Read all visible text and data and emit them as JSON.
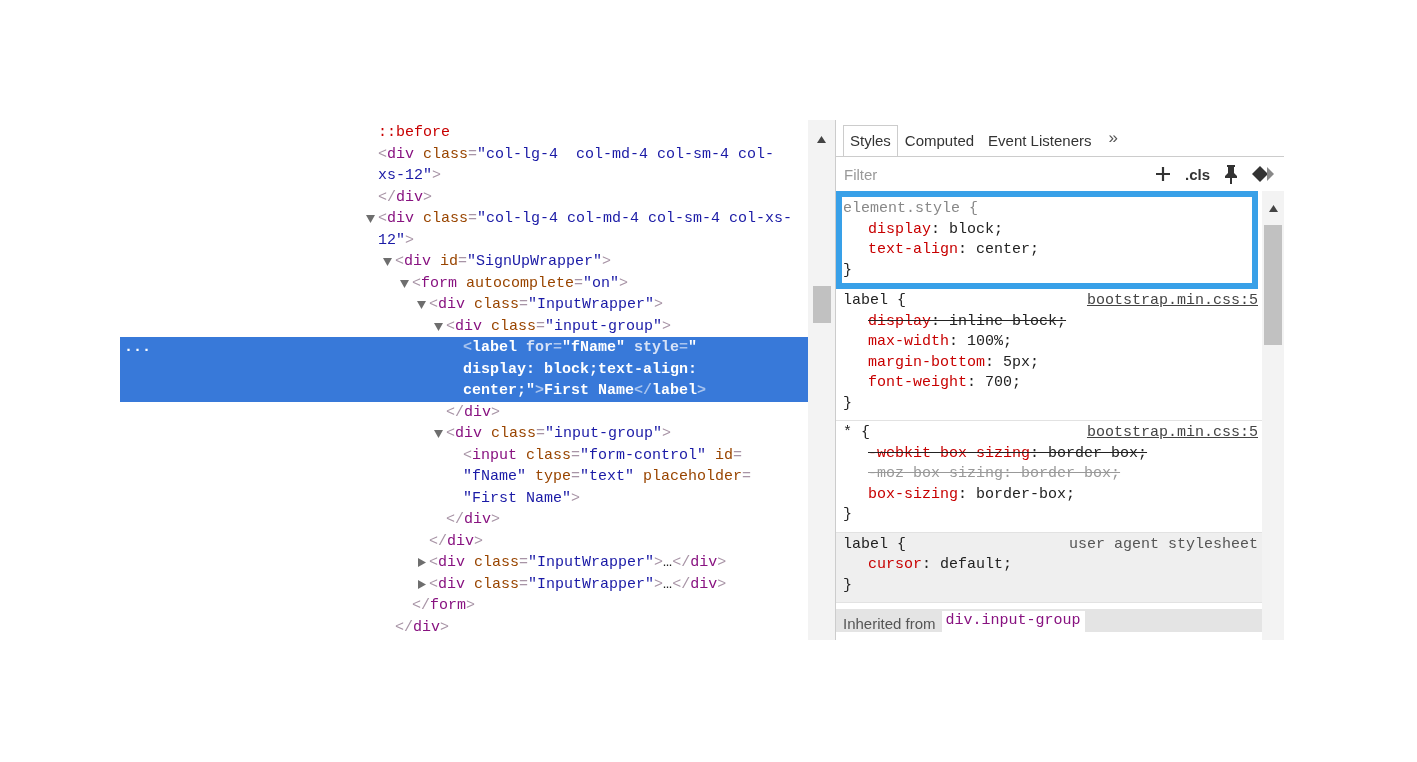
{
  "elements": {
    "tree": [
      {
        "selected": false,
        "lines": [
          [
            {
              "kind": "pseudo",
              "text": "::before"
            }
          ]
        ]
      },
      {
        "selected": false,
        "lines": [
          [
            {
              "kind": "punct",
              "text": "<"
            },
            {
              "kind": "tag",
              "text": "div"
            },
            {
              "kind": "attr",
              "text": " class"
            },
            {
              "kind": "punct",
              "text": "="
            },
            {
              "kind": "value",
              "text": "\"col-lg-4  col-md-4 col-sm-4 col-"
            }
          ],
          [
            {
              "kind": "value",
              "text": "xs-12\""
            },
            {
              "kind": "punct",
              "text": ">"
            }
          ]
        ],
        "close": [
          {
            "kind": "punct",
            "text": "</"
          },
          {
            "kind": "tag",
            "text": "div"
          },
          {
            "kind": "punct",
            "text": ">"
          }
        ]
      },
      {
        "selected": false,
        "expanded": true,
        "lines": [
          [
            {
              "kind": "punct",
              "text": "<"
            },
            {
              "kind": "tag",
              "text": "div"
            },
            {
              "kind": "attr",
              "text": " class"
            },
            {
              "kind": "punct",
              "text": "="
            },
            {
              "kind": "value",
              "text": "\"col-lg-4 col-md-4 col-sm-4 col-xs-"
            }
          ],
          [
            {
              "kind": "value",
              "text": "12\""
            },
            {
              "kind": "punct",
              "text": ">"
            }
          ]
        ],
        "children": [
          {
            "selected": false,
            "expanded": true,
            "lines": [
              [
                {
                  "kind": "punct",
                  "text": "<"
                },
                {
                  "kind": "tag",
                  "text": "div"
                },
                {
                  "kind": "attr",
                  "text": " id"
                },
                {
                  "kind": "punct",
                  "text": "="
                },
                {
                  "kind": "value",
                  "text": "\"SignUpWrapper\""
                },
                {
                  "kind": "punct",
                  "text": ">"
                }
              ]
            ],
            "close": [
              {
                "kind": "punct",
                "text": "</"
              },
              {
                "kind": "tag",
                "text": "div"
              },
              {
                "kind": "punct",
                "text": ">"
              }
            ],
            "children": [
              {
                "selected": false,
                "expanded": true,
                "lines": [
                  [
                    {
                      "kind": "punct",
                      "text": "<"
                    },
                    {
                      "kind": "tag",
                      "text": "form"
                    },
                    {
                      "kind": "attr",
                      "text": " autocomplete"
                    },
                    {
                      "kind": "punct",
                      "text": "="
                    },
                    {
                      "kind": "value",
                      "text": "\"on\""
                    },
                    {
                      "kind": "punct",
                      "text": ">"
                    }
                  ]
                ],
                "close": [
                  {
                    "kind": "punct",
                    "text": "</"
                  },
                  {
                    "kind": "tag",
                    "text": "form"
                  },
                  {
                    "kind": "punct",
                    "text": ">"
                  }
                ],
                "children": [
                  {
                    "selected": false,
                    "expanded": true,
                    "lines": [
                      [
                        {
                          "kind": "punct",
                          "text": "<"
                        },
                        {
                          "kind": "tag",
                          "text": "div"
                        },
                        {
                          "kind": "attr",
                          "text": " class"
                        },
                        {
                          "kind": "punct",
                          "text": "="
                        },
                        {
                          "kind": "value",
                          "text": "\"InputWrapper\""
                        },
                        {
                          "kind": "punct",
                          "text": ">"
                        }
                      ]
                    ],
                    "close": [
                      {
                        "kind": "punct",
                        "text": "</"
                      },
                      {
                        "kind": "tag",
                        "text": "div"
                      },
                      {
                        "kind": "punct",
                        "text": ">"
                      }
                    ],
                    "children": [
                      {
                        "selected": false,
                        "expanded": true,
                        "lines": [
                          [
                            {
                              "kind": "punct",
                              "text": "<"
                            },
                            {
                              "kind": "tag",
                              "text": "div"
                            },
                            {
                              "kind": "attr",
                              "text": " class"
                            },
                            {
                              "kind": "punct",
                              "text": "="
                            },
                            {
                              "kind": "value",
                              "text": "\"input-group\""
                            },
                            {
                              "kind": "punct",
                              "text": ">"
                            }
                          ]
                        ],
                        "close": [
                          {
                            "kind": "punct",
                            "text": "</"
                          },
                          {
                            "kind": "tag",
                            "text": "div"
                          },
                          {
                            "kind": "punct",
                            "text": ">"
                          }
                        ],
                        "children": [
                          {
                            "selected": true,
                            "gutter": "...",
                            "lines": [
                              [
                                {
                                  "kind": "punct",
                                  "text": "<"
                                },
                                {
                                  "kind": "tag",
                                  "text": "label"
                                },
                                {
                                  "kind": "attr",
                                  "text": " for"
                                },
                                {
                                  "kind": "punct",
                                  "text": "="
                                },
                                {
                                  "kind": "value",
                                  "text": "\"fName\""
                                },
                                {
                                  "kind": "attr",
                                  "text": " style"
                                },
                                {
                                  "kind": "punct",
                                  "text": "="
                                },
                                {
                                  "kind": "value",
                                  "text": "\""
                                }
                              ],
                              [
                                {
                                  "kind": "value",
                                  "text": "display: block;text-align:"
                                }
                              ],
                              [
                                {
                                  "kind": "value",
                                  "text": "center;\""
                                },
                                {
                                  "kind": "punct",
                                  "text": ">"
                                },
                                {
                                  "kind": "text",
                                  "text": "First Name"
                                },
                                {
                                  "kind": "punct",
                                  "text": "</"
                                },
                                {
                                  "kind": "tag",
                                  "text": "label"
                                },
                                {
                                  "kind": "punct",
                                  "text": ">"
                                }
                              ]
                            ]
                          }
                        ]
                      },
                      {
                        "selected": false,
                        "expanded": true,
                        "lines": [
                          [
                            {
                              "kind": "punct",
                              "text": "<"
                            },
                            {
                              "kind": "tag",
                              "text": "div"
                            },
                            {
                              "kind": "attr",
                              "text": " class"
                            },
                            {
                              "kind": "punct",
                              "text": "="
                            },
                            {
                              "kind": "value",
                              "text": "\"input-group\""
                            },
                            {
                              "kind": "punct",
                              "text": ">"
                            }
                          ]
                        ],
                        "close": [
                          {
                            "kind": "punct",
                            "text": "</"
                          },
                          {
                            "kind": "tag",
                            "text": "div"
                          },
                          {
                            "kind": "punct",
                            "text": ">"
                          }
                        ],
                        "children": [
                          {
                            "selected": false,
                            "lines": [
                              [
                                {
                                  "kind": "punct",
                                  "text": "<"
                                },
                                {
                                  "kind": "tag",
                                  "text": "input"
                                },
                                {
                                  "kind": "attr",
                                  "text": " class"
                                },
                                {
                                  "kind": "punct",
                                  "text": "="
                                },
                                {
                                  "kind": "value",
                                  "text": "\"form-control\""
                                },
                                {
                                  "kind": "attr",
                                  "text": " id"
                                },
                                {
                                  "kind": "punct",
                                  "text": "="
                                }
                              ],
                              [
                                {
                                  "kind": "value",
                                  "text": "\"fName\""
                                },
                                {
                                  "kind": "attr",
                                  "text": " type"
                                },
                                {
                                  "kind": "punct",
                                  "text": "="
                                },
                                {
                                  "kind": "value",
                                  "text": "\"text\""
                                },
                                {
                                  "kind": "attr",
                                  "text": " placeholder"
                                },
                                {
                                  "kind": "punct",
                                  "text": "="
                                }
                              ],
                              [
                                {
                                  "kind": "value",
                                  "text": "\"First Name\""
                                },
                                {
                                  "kind": "punct",
                                  "text": ">"
                                }
                              ]
                            ]
                          }
                        ]
                      }
                    ]
                  },
                  {
                    "selected": false,
                    "expanded": false,
                    "lines": [
                      [
                        {
                          "kind": "punct",
                          "text": "<"
                        },
                        {
                          "kind": "tag",
                          "text": "div"
                        },
                        {
                          "kind": "attr",
                          "text": " class"
                        },
                        {
                          "kind": "punct",
                          "text": "="
                        },
                        {
                          "kind": "value",
                          "text": "\"InputWrapper\""
                        },
                        {
                          "kind": "punct",
                          "text": ">"
                        },
                        {
                          "kind": "text",
                          "text": "…"
                        },
                        {
                          "kind": "punct",
                          "text": "</"
                        },
                        {
                          "kind": "tag",
                          "text": "div"
                        },
                        {
                          "kind": "punct",
                          "text": ">"
                        }
                      ]
                    ]
                  },
                  {
                    "selected": false,
                    "expanded": false,
                    "lines": [
                      [
                        {
                          "kind": "punct",
                          "text": "<"
                        },
                        {
                          "kind": "tag",
                          "text": "div"
                        },
                        {
                          "kind": "attr",
                          "text": " class"
                        },
                        {
                          "kind": "punct",
                          "text": "="
                        },
                        {
                          "kind": "value",
                          "text": "\"InputWrapper\""
                        },
                        {
                          "kind": "punct",
                          "text": ">"
                        },
                        {
                          "kind": "text",
                          "text": "…"
                        },
                        {
                          "kind": "punct",
                          "text": "</"
                        },
                        {
                          "kind": "tag",
                          "text": "div"
                        },
                        {
                          "kind": "punct",
                          "text": ">"
                        }
                      ]
                    ]
                  }
                ]
              }
            ]
          }
        ]
      }
    ]
  },
  "styles": {
    "tabs": [
      {
        "label": "Styles",
        "selected": true
      },
      {
        "label": "Computed",
        "selected": false
      },
      {
        "label": "Event Listeners",
        "selected": false
      }
    ],
    "more": "»",
    "filter": {
      "placeholder": "Filter"
    },
    "cls": ".cls",
    "rules": [
      {
        "selector": "element.style {",
        "kind": "inline",
        "highlighted": true,
        "declarations": [
          {
            "text": "display: block;",
            "kind": "active"
          },
          {
            "text": "text-align: center;",
            "kind": "active"
          }
        ],
        "close": "}"
      },
      {
        "selector": "label {",
        "kind": "author",
        "highlighted": false,
        "source": "bootstrap.min.css:5",
        "declarations": [
          {
            "text": "display: inline block;",
            "kind": "overridden"
          },
          {
            "text": "max-width: 100%;",
            "kind": "active"
          },
          {
            "text": "margin-bottom: 5px;",
            "kind": "active"
          },
          {
            "text": "font-weight: 700;",
            "kind": "active"
          }
        ],
        "close": "}"
      },
      {
        "selector": "* {",
        "kind": "author",
        "highlighted": false,
        "source": "bootstrap.min.css:5",
        "declarations": [
          {
            "text": "-webkit box sizing: border box;",
            "kind": "overridden"
          },
          {
            "text": "-moz box sizing: border box;",
            "kind": "unsupported"
          },
          {
            "text": "box-sizing: border-box;",
            "kind": "active"
          }
        ],
        "close": "}"
      },
      {
        "selector": "label {",
        "kind": "useragent",
        "highlighted": false,
        "source": "user agent stylesheet",
        "declarations": [
          {
            "text": "cursor: default;",
            "kind": "active"
          }
        ],
        "close": "}"
      }
    ],
    "inherited": {
      "label": "Inherited from",
      "source": "div.input-group"
    }
  }
}
